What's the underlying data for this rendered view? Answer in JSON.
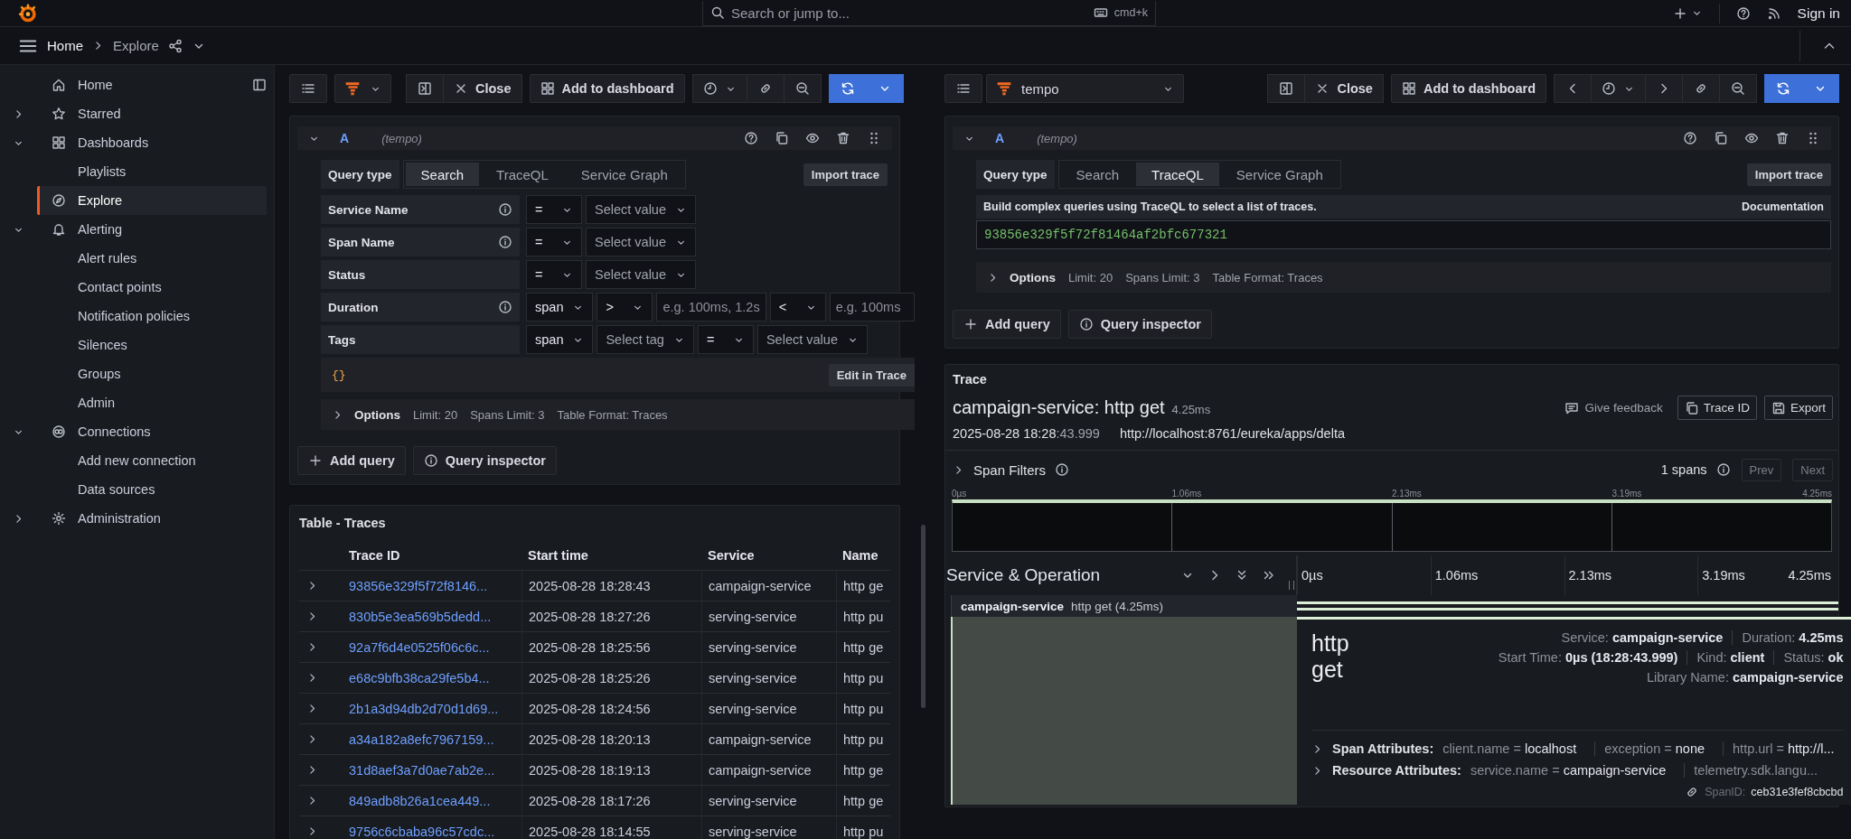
{
  "top_bar": {
    "search": {
      "placeholder": "Search or jump to...",
      "shortcut": "cmd+k"
    },
    "sign_in": "Sign in"
  },
  "breadcrumbs": [
    "Home",
    "Explore"
  ],
  "sidebar": {
    "items": [
      {
        "label": "Home",
        "selected": false
      },
      {
        "label": "Starred",
        "selected": false,
        "expanded": false
      },
      {
        "label": "Dashboards",
        "selected": false,
        "expanded": true,
        "children": [
          {
            "label": "Playlists",
            "selected": false
          }
        ]
      },
      {
        "label": "Explore",
        "selected": true
      },
      {
        "label": "Alerting",
        "selected": false,
        "expanded": true,
        "children": [
          {
            "label": "Alert rules",
            "selected": false
          },
          {
            "label": "Contact points",
            "selected": false
          },
          {
            "label": "Notification policies",
            "selected": false
          },
          {
            "label": "Silences",
            "selected": false
          },
          {
            "label": "Groups",
            "selected": false
          },
          {
            "label": "Admin",
            "selected": false
          }
        ]
      },
      {
        "label": "Connections",
        "selected": false,
        "expanded": true,
        "children": [
          {
            "label": "Add new connection",
            "selected": false
          },
          {
            "label": "Data sources",
            "selected": false
          }
        ]
      },
      {
        "label": "Administration",
        "selected": false,
        "expanded": false
      }
    ]
  },
  "left_pane": {
    "toolbar": {
      "close": "Close",
      "add_to_dashboard": "Add to dashboard",
      "time_nav": false
    },
    "query": {
      "ref": "A",
      "datasource": "(tempo)",
      "expanded": true,
      "query_type_label": "Query type",
      "query_types": [
        {
          "label": "Search",
          "selected": true
        },
        {
          "label": "TraceQL",
          "selected": false
        },
        {
          "label": "Service Graph",
          "selected": false
        }
      ],
      "import": "Import trace",
      "kind": "search",
      "fields": [
        {
          "label": "Service Name",
          "info": true,
          "controls": [
            {
              "kind": "select",
              "value": "="
            },
            {
              "kind": "select",
              "placeholder": "Select value"
            }
          ]
        },
        {
          "label": "Span Name",
          "info": true,
          "controls": [
            {
              "kind": "select",
              "value": "="
            },
            {
              "kind": "select",
              "placeholder": "Select value"
            }
          ]
        },
        {
          "label": "Status",
          "info": false,
          "controls": [
            {
              "kind": "select",
              "value": "="
            },
            {
              "kind": "select",
              "placeholder": "Select value"
            }
          ]
        },
        {
          "label": "Duration",
          "info": true,
          "controls": [
            {
              "kind": "select",
              "value": "span"
            },
            {
              "kind": "select",
              "value": ">"
            },
            {
              "kind": "input",
              "placeholder": "e.g. 100ms, 1.2s"
            },
            {
              "kind": "select",
              "value": "<"
            },
            {
              "kind": "input",
              "placeholder": "e.g. 100ms"
            }
          ]
        },
        {
          "label": "Tags",
          "info": false,
          "controls": [
            {
              "kind": "select",
              "value": "span"
            },
            {
              "kind": "select",
              "placeholder": "Select tag"
            },
            {
              "kind": "select",
              "value": "="
            },
            {
              "kind": "select",
              "placeholder": "Select value"
            }
          ]
        }
      ],
      "preview": "{}",
      "edit_button": "Edit in Trace",
      "options": {
        "label": "Options",
        "expanded": false,
        "summary": [
          "Limit: 20",
          "Spans Limit: 3",
          "Table Format: Traces"
        ]
      },
      "actions": [
        "Add query",
        "Query inspector"
      ]
    },
    "table": {
      "title": "Table - Traces",
      "columns": [
        "Trace ID",
        "Start time",
        "Service",
        "Name"
      ],
      "rows": [
        {
          "trace_id": "93856e329f5f72f8146...",
          "start_time": "2025-08-28 18:28:43",
          "service": "campaign-service",
          "name": "http ge"
        },
        {
          "trace_id": "830b5e3ea569b5dedd...",
          "start_time": "2025-08-28 18:27:26",
          "service": "serving-service",
          "name": "http pu"
        },
        {
          "trace_id": "92a7f6d4e0525f06c6c...",
          "start_time": "2025-08-28 18:25:56",
          "service": "serving-service",
          "name": "http ge"
        },
        {
          "trace_id": "e68c9bfb38ca29fe5b4...",
          "start_time": "2025-08-28 18:25:26",
          "service": "serving-service",
          "name": "http pu"
        },
        {
          "trace_id": "2b1a3d94db2d70d1d69...",
          "start_time": "2025-08-28 18:24:56",
          "service": "serving-service",
          "name": "http pu"
        },
        {
          "trace_id": "a34a182a8efc7967159...",
          "start_time": "2025-08-28 18:20:13",
          "service": "campaign-service",
          "name": "http pu"
        },
        {
          "trace_id": "31d8aef3a7d0ae7ab2e...",
          "start_time": "2025-08-28 18:19:13",
          "service": "campaign-service",
          "name": "http ge"
        },
        {
          "trace_id": "849adb8b26a1cea449...",
          "start_time": "2025-08-28 18:17:26",
          "service": "serving-service",
          "name": "http ge"
        },
        {
          "trace_id": "9756c6cbaba96c57cdc...",
          "start_time": "2025-08-28 18:14:55",
          "service": "serving-service",
          "name": "http pu"
        }
      ]
    }
  },
  "right_pane": {
    "toolbar": {
      "datasource": "tempo",
      "close": "Close",
      "add_to_dashboard": "Add to dashboard",
      "time_nav": true
    },
    "query": {
      "ref": "A",
      "datasource": "(tempo)",
      "expanded": true,
      "query_type_label": "Query type",
      "query_types": [
        {
          "label": "Search",
          "selected": false
        },
        {
          "label": "TraceQL",
          "selected": true
        },
        {
          "label": "Service Graph",
          "selected": false
        }
      ],
      "import": "Import trace",
      "kind": "traceql",
      "help": "Build complex queries using TraceQL to select a list of traces.",
      "documentation": "Documentation",
      "value": "93856e329f5f72f81464af2bfc677321",
      "options": {
        "label": "Options",
        "expanded": false,
        "summary": [
          "Limit: 20",
          "Spans Limit: 3",
          "Table Format: Traces"
        ]
      },
      "actions": [
        "Add query",
        "Query inspector"
      ]
    },
    "trace": {
      "panel_title": "Trace",
      "title": "campaign-service: http get",
      "duration": "4.25ms",
      "feedback": "Give feedback",
      "trace_id_button": "Trace ID",
      "export": "Export",
      "start_date": "2025-08-28 18:28",
      "start_seconds": ":43.999",
      "url": "http://localhost:8761/eureka/apps/delta",
      "span_filters": {
        "label": "Span Filters",
        "expanded": false,
        "count": "1 spans",
        "prev": {
          "label": "Prev",
          "disabled": true
        },
        "next": {
          "label": "Next",
          "disabled": true
        }
      },
      "minimap_ticks": [
        "0µs",
        "1.06ms",
        "2.13ms",
        "3.19ms",
        "4.25ms"
      ],
      "header": "Service & Operation",
      "timeline_ticks": [
        "0µs",
        "1.06ms",
        "2.13ms",
        "3.19ms",
        "4.25ms"
      ],
      "spans": [
        {
          "service": "campaign-service",
          "operation": "http get (4.25ms)",
          "expanded": true,
          "detail": {
            "title": "http get",
            "field_lines": [
              [
                "Service: **campaign-service**",
                "Duration: **4.25ms**"
              ],
              [
                "Start Time: **0µs (18:28:43.999)**",
                "Kind: **client**",
                "Status: **ok**"
              ],
              [
                "Library Name: **campaign-service**"
              ]
            ],
            "attribute_groups": [
              {
                "label": "Span Attributes:",
                "expanded": false,
                "items": [
                  "client.name = **localhost**",
                  "exception = **none**",
                  "http.url = **http://l...**"
                ]
              },
              {
                "label": "Resource Attributes:",
                "expanded": false,
                "items": [
                  "service.name = **campaign-service**",
                  "telemetry.sdk.langu..."
                ]
              }
            ],
            "span_id_label": "SpanID:",
            "span_id": "ceb31e3fef8cbcbd"
          }
        }
      ]
    }
  }
}
